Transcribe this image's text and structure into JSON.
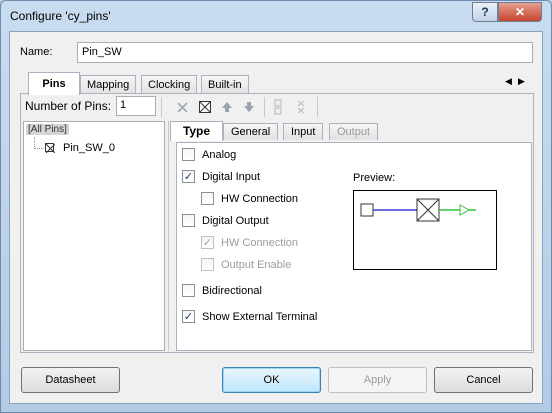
{
  "window": {
    "title": "Configure 'cy_pins'",
    "help_label": "?",
    "close_label": "✕"
  },
  "name_label": "Name:",
  "name_value": "Pin_SW",
  "tabs": [
    "Pins",
    "Mapping",
    "Clocking",
    "Built-in"
  ],
  "tab_scroll": {
    "left": "◀",
    "right": "▶"
  },
  "pins": {
    "num_label": "Number of Pins:",
    "num_value": "1",
    "tree": {
      "root": "[All Pins]",
      "items": [
        "Pin_SW_0"
      ]
    }
  },
  "inner_tabs": [
    "Type",
    "General",
    "Input",
    "Output"
  ],
  "options": {
    "analog": "Analog",
    "digital_input": "Digital Input",
    "hw_connection_in": "HW Connection",
    "digital_output": "Digital Output",
    "hw_connection_out": "HW Connection",
    "output_enable": "Output Enable",
    "bidirectional": "Bidirectional",
    "show_external_terminal": "Show External Terminal"
  },
  "checked": {
    "analog": false,
    "digital_input": true,
    "hw_connection_in": false,
    "digital_output": false,
    "hw_connection_out": true,
    "output_enable": false,
    "bidirectional": false,
    "show_external_terminal": true
  },
  "preview_label": "Preview:",
  "buttons": {
    "datasheet": "Datasheet",
    "ok": "OK",
    "apply": "Apply",
    "cancel": "Cancel"
  },
  "colors": {
    "wire_blue": "#3a3ad8",
    "wire_green": "#36c036",
    "selection": "#d5d5d5"
  },
  "icons": [
    "delete-icon",
    "pin-select-icon",
    "move-up-icon",
    "move-down-icon",
    "split-icon",
    "join-icon"
  ]
}
